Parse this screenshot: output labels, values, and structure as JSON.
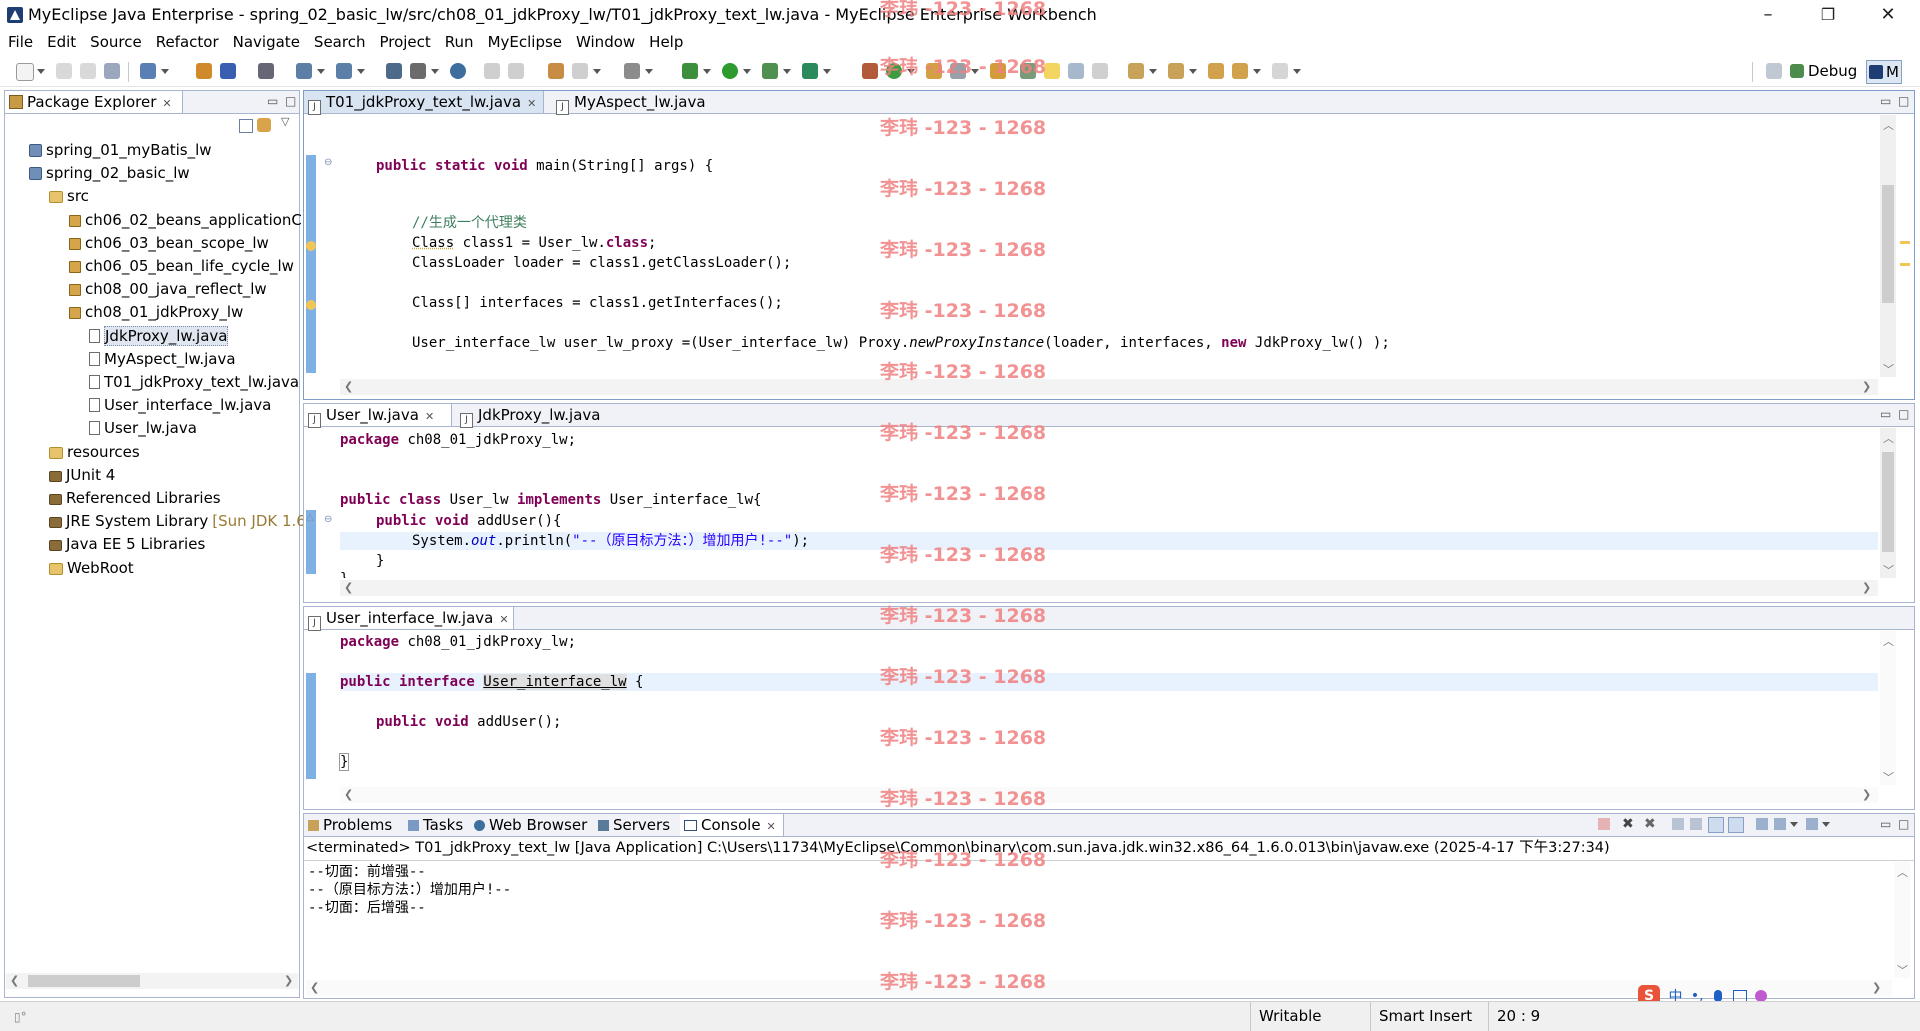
{
  "window": {
    "title": "MyEclipse Java Enterprise - spring_02_basic_lw/src/ch08_01_jdkProxy_lw/T01_jdkProxy_text_lw.java - MyEclipse Enterprise Workbench",
    "minimize": "–",
    "restore": "❐",
    "close": "✕"
  },
  "menu": [
    "File",
    "Edit",
    "Source",
    "Refactor",
    "Navigate",
    "Search",
    "Project",
    "Run",
    "MyEclipse",
    "Window",
    "Help"
  ],
  "perspective": {
    "debug_label": "Debug",
    "active_label": "M"
  },
  "package_explorer": {
    "title": "Package Explorer",
    "tree": [
      {
        "label": "spring_01_myBatis_lw",
        "icon": "project-icon"
      },
      {
        "label": "spring_02_basic_lw",
        "icon": "project-icon"
      },
      {
        "label": "src",
        "icon": "source-folder-icon"
      },
      {
        "label": "ch06_02_beans_applicationC",
        "icon": "package-icon"
      },
      {
        "label": "ch06_03_bean_scope_lw",
        "icon": "package-icon"
      },
      {
        "label": "ch06_05_bean_life_cycle_lw",
        "icon": "package-icon"
      },
      {
        "label": "ch08_00_java_reflect_lw",
        "icon": "package-icon"
      },
      {
        "label": "ch08_01_jdkProxy_lw",
        "icon": "package-icon"
      },
      {
        "label": "JdkProxy_lw.java",
        "icon": "java-file-icon"
      },
      {
        "label": "MyAspect_lw.java",
        "icon": "java-file-icon"
      },
      {
        "label": "T01_jdkProxy_text_lw.java",
        "icon": "java-file-icon"
      },
      {
        "label": "User_interface_lw.java",
        "icon": "java-file-icon"
      },
      {
        "label": "User_lw.java",
        "icon": "java-file-icon"
      },
      {
        "label": "resources",
        "icon": "source-folder-icon"
      },
      {
        "label": "JUnit 4",
        "icon": "library-icon"
      },
      {
        "label": "Referenced Libraries",
        "icon": "library-icon"
      },
      {
        "label": "JRE System Library",
        "suffix": "[Sun JDK 1.6",
        "icon": "library-icon"
      },
      {
        "label": "Java EE 5 Libraries",
        "icon": "library-icon"
      },
      {
        "label": "WebRoot",
        "icon": "folder-icon"
      }
    ]
  },
  "editor1": {
    "tabs": [
      "T01_jdkProxy_text_lw.java",
      "MyAspect_lw.java"
    ],
    "lines": {
      "main_kw1": "public static void",
      "main_rest": " main(String[] args) {",
      "comment": "//生成一个代理类",
      "class_a": "Class",
      "class_b": " class1 = User_lw.",
      "class_kw": "class",
      "class_c": ";",
      "loader": "ClassLoader loader = class1.getClassLoader();",
      "ifaces": "Class[] interfaces = class1.getInterfaces();",
      "proxy_a": "User_interface_lw user_lw_proxy =(User_interface_lw) Proxy.",
      "proxy_it": "newProxyInstance",
      "proxy_b": "(loader, interfaces, ",
      "proxy_kw": "new",
      "proxy_c": " JdkProxy_lw() );"
    }
  },
  "editor2": {
    "tabs": [
      "User_lw.java",
      "JdkProxy_lw.java"
    ],
    "lines": {
      "pkg_kw": "package",
      "pkg_rest": " ch08_01_jdkProxy_lw;",
      "cls_kw1": "public class",
      "cls_mid": " User_lw ",
      "cls_kw2": "implements",
      "cls_rest": " User_interface_lw{",
      "m_kw": "public void",
      "m_rest": " addUser(){",
      "p_a": "System.",
      "p_fld": "out",
      "p_b": ".println(",
      "p_str": "\"--（原目标方法：）增加用户!--\"",
      "p_c": ");",
      "close1": "}",
      "close2": "}"
    }
  },
  "editor3": {
    "tabs": [
      "User_interface_lw.java"
    ],
    "lines": {
      "pkg_kw": "package",
      "pkg_rest": " ch08_01_jdkProxy_lw;",
      "i_kw": "public interface",
      "i_name": "User_interface_lw",
      "i_rest": " {",
      "m_kw": "public void",
      "m_rest": " addUser();",
      "close": "}"
    }
  },
  "bottom_panel": {
    "tabs": [
      "Problems",
      "Tasks",
      "Web Browser",
      "Servers",
      "Console"
    ],
    "console_header": "<terminated> T01_jdkProxy_text_lw [Java Application] C:\\Users\\11734\\MyEclipse\\Common\\binary\\com.sun.java.jdk.win32.x86_64_1.6.0.013\\bin\\javaw.exe (2025-4-17 下午3:27:34)",
    "output": [
      "--切面：前增强--",
      "--（原目标方法：）增加用户!--",
      "--切面：后增强--"
    ]
  },
  "watermark": "李玮 -123 - 1268",
  "status": {
    "writable": "Writable",
    "insert_mode": "Smart Insert",
    "position": "20 : 9"
  },
  "ime": {
    "logo": "S",
    "lang": "中"
  },
  "colors": {
    "keyword": "#7f0055",
    "comment": "#3f7f5f",
    "string": "#2a00ff",
    "field": "#0000c0",
    "watermark": "#f08080",
    "panel_border": "#a7b6ce"
  }
}
